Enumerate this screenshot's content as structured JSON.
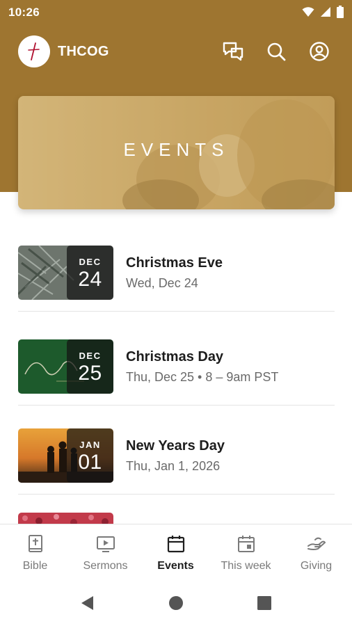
{
  "status_bar": {
    "time": "10:26",
    "icons": [
      "wifi-icon",
      "signal-icon",
      "battery-icon"
    ]
  },
  "appbar": {
    "title": "THCOG",
    "actions": [
      "chat-icon",
      "search-icon",
      "account-icon"
    ]
  },
  "hero": {
    "title": "EVENTS"
  },
  "events": [
    {
      "month": "DEC",
      "day": "24",
      "title": "Christmas Eve",
      "subtitle": "Wed, Dec 24"
    },
    {
      "month": "DEC",
      "day": "25",
      "title": "Christmas Day",
      "subtitle": "Thu, Dec 25 • 8 – 9am PST"
    },
    {
      "month": "JAN",
      "day": "01",
      "title": "New Years Day",
      "subtitle": "Thu, Jan 1, 2026"
    }
  ],
  "bottom_nav": {
    "items": [
      {
        "label": "Bible",
        "icon": "bible-icon",
        "active": false
      },
      {
        "label": "Sermons",
        "icon": "sermons-icon",
        "active": false
      },
      {
        "label": "Events",
        "icon": "events-calendar-icon",
        "active": true
      },
      {
        "label": "This week",
        "icon": "this-week-calendar-icon",
        "active": false
      },
      {
        "label": "Giving",
        "icon": "giving-hand-icon",
        "active": false
      }
    ]
  },
  "colors": {
    "brand": "#9e7530",
    "active_nav": "#1f1f1f",
    "inactive_nav": "#7a7a7a"
  }
}
